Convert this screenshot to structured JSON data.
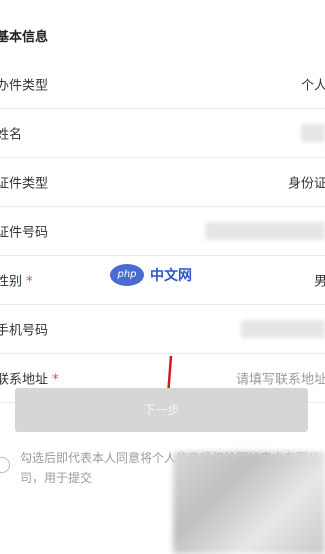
{
  "section": {
    "title": "基本信息"
  },
  "rows": [
    {
      "label": "办件类型",
      "value": "个人",
      "required": ""
    },
    {
      "label": "姓名",
      "value": "",
      "required": ""
    },
    {
      "label": "证件类型",
      "value": "身份证",
      "required": ""
    },
    {
      "label": "证件号码",
      "value": "",
      "required": ""
    },
    {
      "label": "性别",
      "value": "男",
      "required": "*"
    },
    {
      "label": "手机号码",
      "value": "",
      "required": ""
    },
    {
      "label": "联系地址",
      "placeholder": "请填写联系地址",
      "required": "*"
    }
  ],
  "next_button": {
    "label": "下一步"
  },
  "agreement": {
    "text": "勾选后即代表本人同意将个人信息授权给网站来水有限公司，用于提交"
  },
  "watermark": {
    "logo": "php",
    "text": "中文网"
  },
  "colors": {
    "accent_red": "#e64340",
    "button_disabled": "#d6d6d6",
    "watermark_blue": "#2f56c9"
  }
}
